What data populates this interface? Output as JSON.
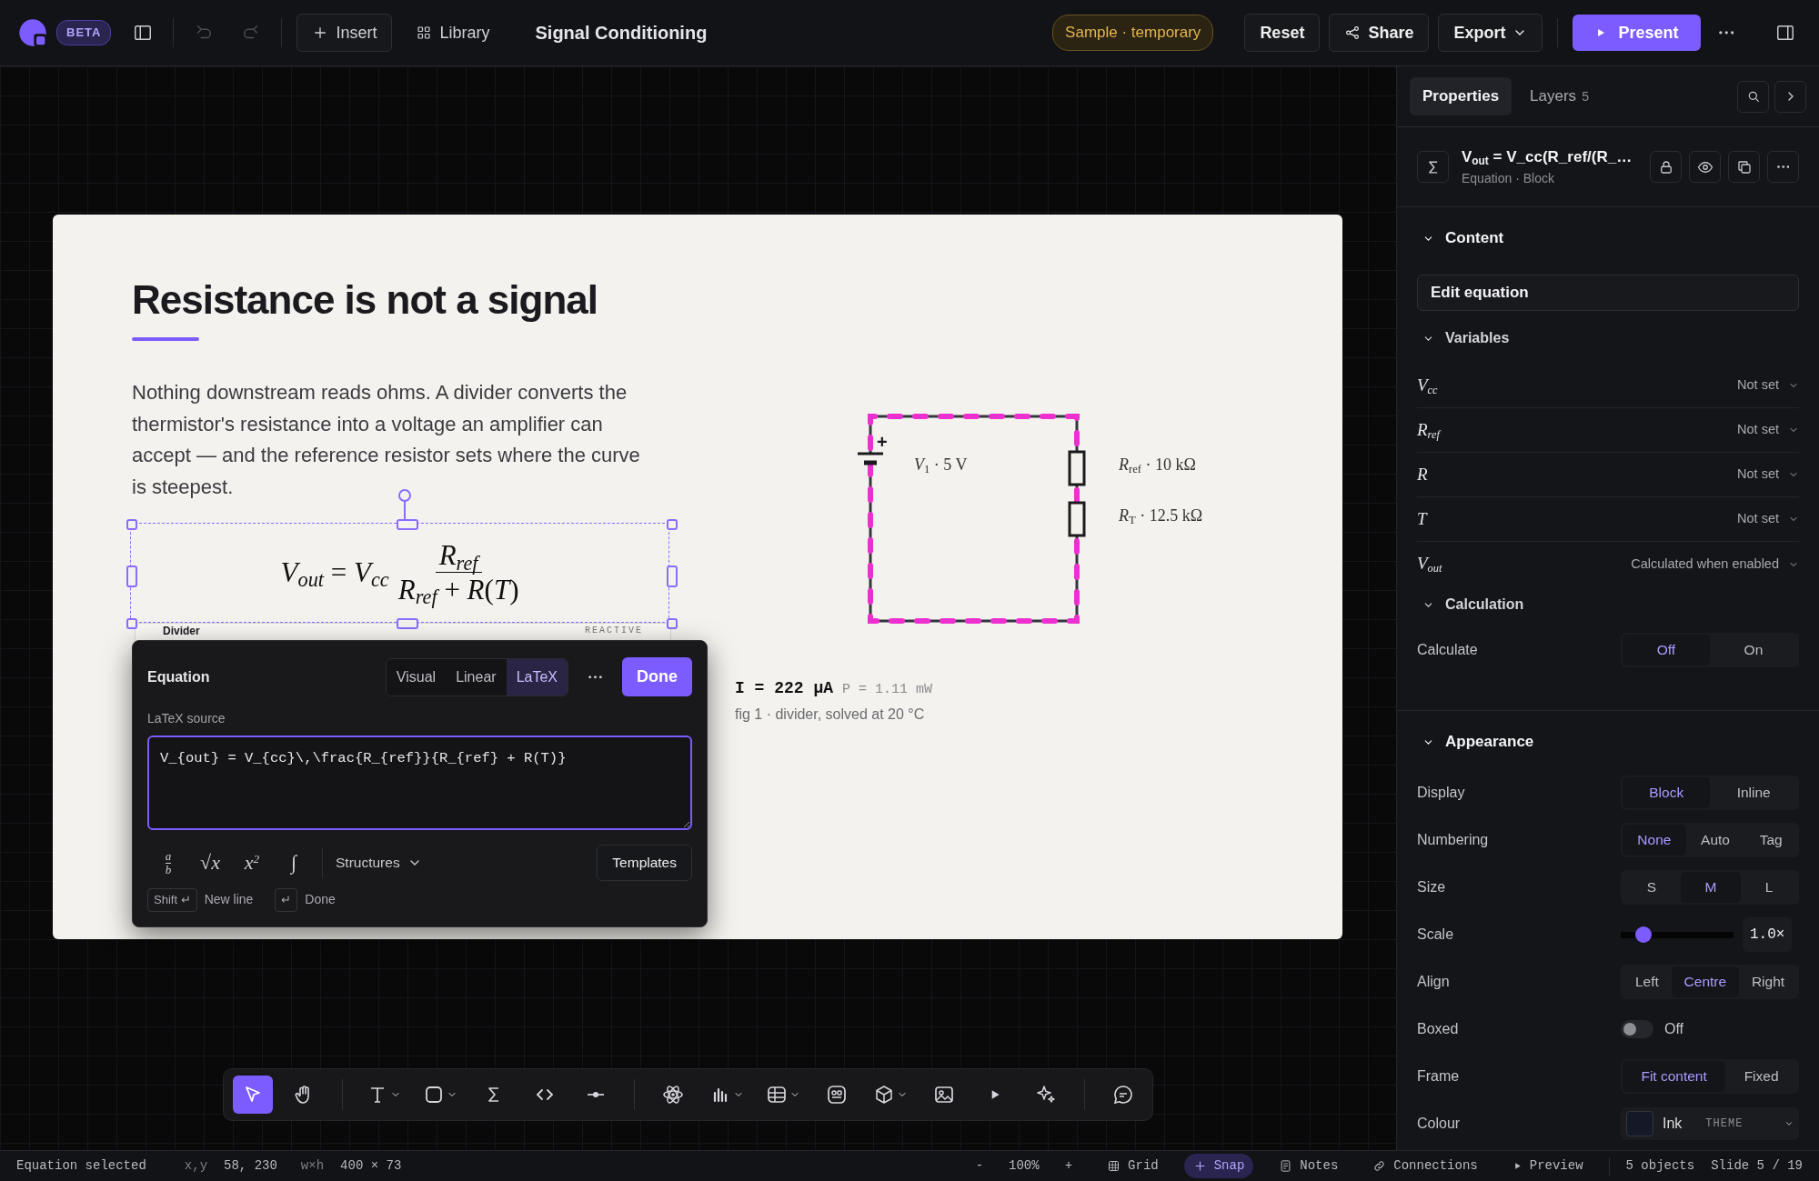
{
  "topbar": {
    "beta": "BETA",
    "undo_disabled": true,
    "redo_disabled": true,
    "insert": "Insert",
    "library": "Library",
    "title": "Signal Conditioning",
    "badge": "Sample · temporary",
    "reset": "Reset",
    "share": "Share",
    "export": "Export",
    "present": "Present"
  },
  "slide": {
    "title": "Resistance is not a signal",
    "paragraph": "Nothing downstream reads ohms. A divider converts the thermistor's resistance into a voltage an amplifier can accept — and the reference resistor sets where the curve is steepest.",
    "equation": {
      "lhs": "*V*$_{out}$ = *V*$_{cc}$",
      "numerator": "*R*$_{ref}$",
      "denominator": "*R*$_{ref}$ + *R*(*T*)"
    },
    "block_below": {
      "label": "Divider",
      "tag": "REACTIVE"
    },
    "circuit": {
      "polarity": "+",
      "source_label": "*V*$_{1}$ · 5 V",
      "resistor_labels": [
        "*R*$_{ref}$ · 10 kΩ",
        "*R*$_{T}$ · 12.5 kΩ"
      ]
    },
    "result": {
      "current": "I = 222 μA",
      "power": "P = 1.11 mW"
    },
    "caption": "fig 1 · divider, solved at 20 °C"
  },
  "editor": {
    "title": "Equation",
    "modes": [
      {
        "label": "Visual",
        "selected": false
      },
      {
        "label": "Linear",
        "selected": false
      },
      {
        "label": "LaTeX",
        "selected": true
      }
    ],
    "done": "Done",
    "source_label": "LaTeX source",
    "source": "V_{out} = V_{cc}\\,\\frac{R_{ref}}{R_{ref} + R(T)}",
    "inserts": [
      {
        "kind": "fraction",
        "top": "a",
        "bottom": "b"
      },
      {
        "kind": "text",
        "text": "√x"
      },
      {
        "kind": "text",
        "text": "x$^{2}$"
      },
      {
        "kind": "text",
        "text": "∫"
      }
    ],
    "structures": "Structures",
    "templates": "Templates",
    "hints": [
      {
        "key": "Shift ↵",
        "text": "New line"
      },
      {
        "key": "↵",
        "text": "Done"
      }
    ]
  },
  "toolbar": {
    "groups": [
      [
        {
          "selected": true,
          "menu": false
        },
        {
          "selected": false,
          "menu": false
        }
      ],
      [
        {
          "selected": false,
          "menu": true
        },
        {
          "selected": false,
          "menu": true
        },
        {
          "selected": false,
          "menu": false
        },
        {
          "selected": false,
          "menu": false
        },
        {
          "selected": false,
          "menu": false
        }
      ],
      [
        {
          "selected": false,
          "menu": false
        },
        {
          "selected": false,
          "menu": true
        },
        {
          "selected": false,
          "menu": true
        },
        {
          "selected": false,
          "menu": false
        },
        {
          "selected": false,
          "menu": true
        },
        {
          "selected": false,
          "menu": false
        },
        {
          "selected": false,
          "menu": false
        },
        {
          "selected": false,
          "menu": false
        }
      ],
      [
        {
          "selected": false,
          "menu": false
        }
      ]
    ]
  },
  "panel": {
    "tabs": [
      {
        "label": "Properties",
        "selected": true
      },
      {
        "label": "Layers",
        "count": "5",
        "selected": false
      }
    ],
    "element": {
      "title": "V$_{out}$ = V_cc(R_ref/(R_…",
      "subtitle": "Equation · Block"
    },
    "content": {
      "heading": "Content",
      "expanded": true,
      "edit_button": "Edit equation"
    },
    "variables": {
      "heading": "Variables",
      "expanded": true,
      "items": [
        {
          "name": "V$_{cc}$",
          "value": "Not set"
        },
        {
          "name": "R$_{ref}$",
          "value": "Not set"
        },
        {
          "name": "R",
          "value": "Not set"
        },
        {
          "name": "T",
          "value": "Not set"
        },
        {
          "name": "V$_{out}$",
          "value": "Calculated when enabled"
        }
      ]
    },
    "calculation": {
      "heading": "Calculation",
      "expanded": true,
      "label": "Calculate",
      "options": [
        {
          "label": "Off",
          "selected": true
        },
        {
          "label": "On",
          "selected": false
        }
      ]
    },
    "appearance": {
      "heading": "Appearance",
      "expanded": true,
      "rows": [
        {
          "kind": "segmented",
          "label": "Display",
          "options": [
            {
              "label": "Block",
              "selected": true
            },
            {
              "label": "Inline",
              "selected": false
            }
          ]
        },
        {
          "kind": "segmented",
          "label": "Numbering",
          "options": [
            {
              "label": "None",
              "selected": true
            },
            {
              "label": "Auto",
              "selected": false
            },
            {
              "label": "Tag",
              "selected": false
            }
          ]
        },
        {
          "kind": "segmented",
          "label": "Size",
          "options": [
            {
              "label": "S",
              "selected": false
            },
            {
              "label": "M",
              "selected": true
            },
            {
              "label": "L",
              "selected": false
            }
          ]
        },
        {
          "kind": "slider",
          "label": "Scale",
          "level": 0.2,
          "reading": "1.0×"
        },
        {
          "kind": "segmented",
          "label": "Align",
          "options": [
            {
              "label": "Left",
              "selected": false
            },
            {
              "label": "Centre",
              "selected": true
            },
            {
              "label": "Right",
              "selected": false
            }
          ]
        },
        {
          "kind": "toggle",
          "label": "Boxed",
          "on": false,
          "state_text": "Off"
        },
        {
          "kind": "segmented",
          "label": "Frame",
          "options": [
            {
              "label": "Fit content",
              "selected": true
            },
            {
              "label": "Fixed",
              "selected": false
            }
          ]
        },
        {
          "kind": "colour",
          "label": "Colour",
          "value": "Ink",
          "source": "THEME"
        }
      ]
    }
  },
  "status": {
    "selection": "Equation selected",
    "position_label": "x,y",
    "position": "58, 230",
    "size_label": "w×h",
    "size": "400 × 73",
    "zoom_out": "-",
    "zoom": "100%",
    "zoom_in": "+",
    "toggles": [
      {
        "label": "Grid",
        "on": false
      },
      {
        "label": "Snap",
        "on": true
      },
      {
        "label": "Notes",
        "on": false
      },
      {
        "label": "Connections",
        "on": false
      },
      {
        "label": "Preview",
        "on": false
      }
    ],
    "objects": "5 objects",
    "slide": "Slide 5 / 19"
  }
}
